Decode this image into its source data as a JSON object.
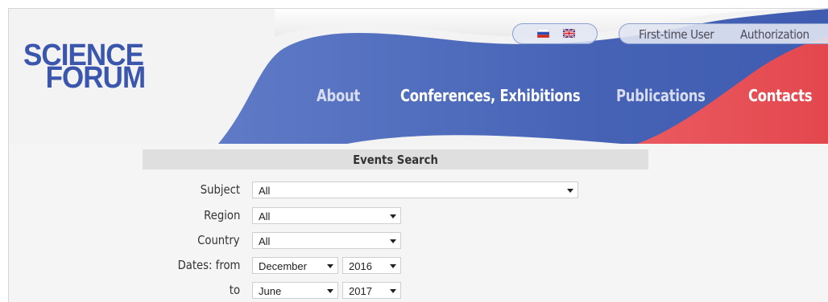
{
  "logo": {
    "line1": "SCIENCE",
    "line2": "FORUM",
    "color": "#3a57ad"
  },
  "header": {
    "languages": [
      {
        "name": "russian-flag-icon"
      },
      {
        "name": "uk-flag-icon"
      }
    ],
    "user_links": {
      "first_time": "First-time User",
      "authorization": "Authorization"
    },
    "nav": {
      "about": "About",
      "conferences": "Conferences, Exhibitions",
      "publications": "Publications",
      "contacts": "Contacts"
    },
    "colors": {
      "blue": "#4a66b8",
      "red": "#e84f55"
    }
  },
  "search": {
    "title": "Events Search",
    "labels": {
      "subject": "Subject",
      "region": "Region",
      "country": "Country",
      "dates_from": "Dates: from",
      "to": "to"
    },
    "values": {
      "subject": "All",
      "region": "All",
      "country": "All",
      "from_month": "December",
      "from_year": "2016",
      "to_month": "June",
      "to_year": "2017"
    }
  }
}
